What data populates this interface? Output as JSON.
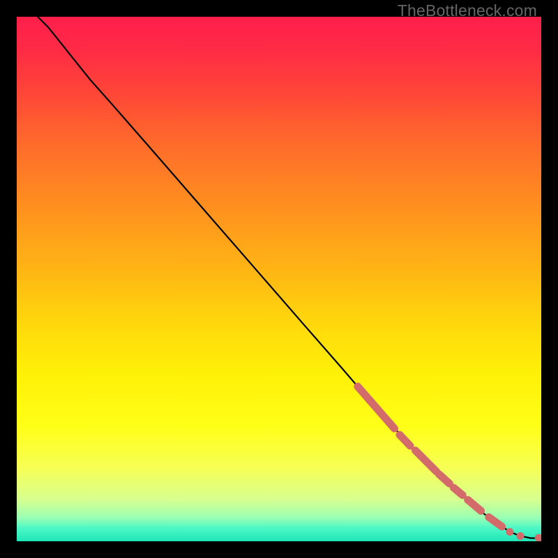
{
  "watermark": "TheBottleneck.com",
  "gradient": {
    "stops": [
      {
        "offset": 0.0,
        "color": "#ff1f4b"
      },
      {
        "offset": 0.06,
        "color": "#ff2a46"
      },
      {
        "offset": 0.14,
        "color": "#ff4438"
      },
      {
        "offset": 0.24,
        "color": "#ff6a2b"
      },
      {
        "offset": 0.36,
        "color": "#ff8f1f"
      },
      {
        "offset": 0.48,
        "color": "#ffb414"
      },
      {
        "offset": 0.58,
        "color": "#ffd60c"
      },
      {
        "offset": 0.68,
        "color": "#fff007"
      },
      {
        "offset": 0.78,
        "color": "#ffff17"
      },
      {
        "offset": 0.86,
        "color": "#f7ff55"
      },
      {
        "offset": 0.92,
        "color": "#d7ff8f"
      },
      {
        "offset": 0.955,
        "color": "#9affb3"
      },
      {
        "offset": 0.975,
        "color": "#4cf7c6"
      },
      {
        "offset": 1.0,
        "color": "#1fe6b8"
      }
    ]
  },
  "chart_data": {
    "type": "line",
    "title": "",
    "xlabel": "",
    "ylabel": "",
    "xlim": [
      0,
      100
    ],
    "ylim": [
      0,
      100
    ],
    "series": [
      {
        "name": "curve",
        "x": [
          4,
          6,
          8,
          10,
          12,
          14,
          18,
          25,
          35,
          45,
          55,
          62,
          68,
          73,
          78,
          82,
          86,
          89,
          92,
          94,
          96,
          98,
          100
        ],
        "y": [
          100,
          98,
          95.5,
          93,
          90.5,
          88,
          83.5,
          75.5,
          64,
          52.5,
          41,
          33,
          26,
          20.5,
          15.5,
          11.5,
          8,
          5.3,
          3.2,
          1.8,
          1.0,
          0.6,
          0.6
        ]
      }
    ],
    "markers": {
      "name": "highlight-segments",
      "color": "#d36b6b",
      "segments": [
        {
          "x0": 65,
          "y0": 29.5,
          "x1": 72,
          "y1": 21.5
        },
        {
          "x0": 73,
          "y0": 20.3,
          "x1": 75,
          "y1": 18.2
        },
        {
          "x0": 76,
          "y0": 17.3,
          "x1": 80,
          "y1": 13.3
        },
        {
          "x0": 80.5,
          "y0": 12.8,
          "x1": 82.5,
          "y1": 11.0
        },
        {
          "x0": 83.3,
          "y0": 10.2,
          "x1": 85.0,
          "y1": 8.8
        },
        {
          "x0": 86.0,
          "y0": 7.9,
          "x1": 88.5,
          "y1": 5.8
        },
        {
          "x0": 90.0,
          "y0": 4.6,
          "x1": 92.5,
          "y1": 2.8
        }
      ],
      "dots": [
        {
          "x": 94.0,
          "y": 1.8
        },
        {
          "x": 96.0,
          "y": 1.0
        },
        {
          "x": 99.5,
          "y": 0.65
        }
      ]
    }
  }
}
